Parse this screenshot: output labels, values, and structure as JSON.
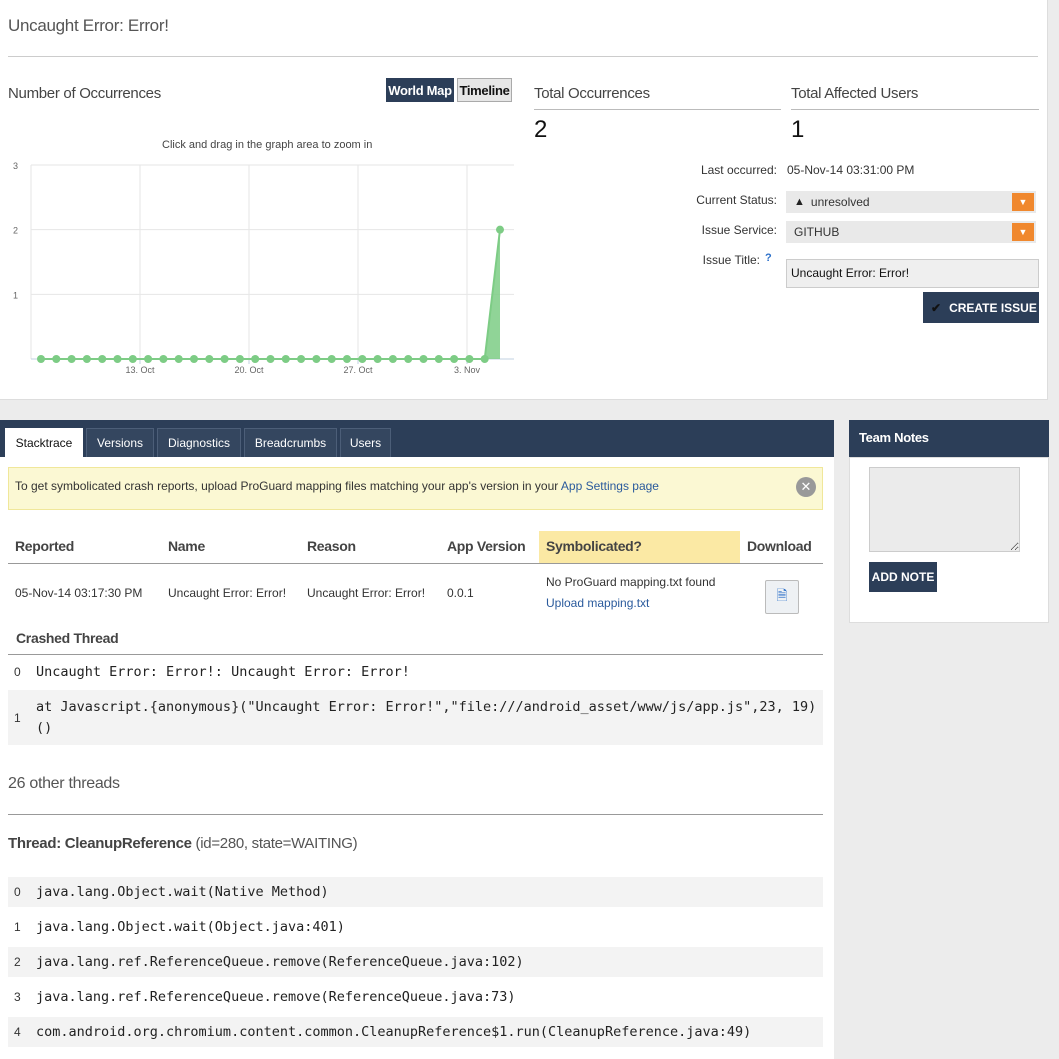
{
  "page": {
    "title": "Uncaught Error: Error!"
  },
  "occurrences": {
    "label": "Number of Occurrences",
    "world_map_label": "World Map",
    "timeline_label": "Timeline",
    "hint": "Click and drag in the graph area to zoom in"
  },
  "chart_data": {
    "type": "area",
    "x_tick_labels": [
      "13. Oct",
      "20. Oct",
      "27. Oct",
      "3. Nov"
    ],
    "y_tick_labels": [
      "1",
      "2",
      "3"
    ],
    "ylim": [
      0,
      3
    ],
    "values": [
      0,
      0,
      0,
      0,
      0,
      0,
      0,
      0,
      0,
      0,
      0,
      0,
      0,
      0,
      0,
      0,
      0,
      0,
      0,
      0,
      0,
      0,
      0,
      0,
      0,
      0,
      0,
      0,
      0,
      0,
      2
    ],
    "color": "#7dcc85",
    "grid": true
  },
  "stats": {
    "total_occurrences_label": "Total Occurrences",
    "total_occurrences_value": "2",
    "total_users_label": "Total Affected Users",
    "total_users_value": "1"
  },
  "meta": {
    "last_occurred_label": "Last occurred:",
    "last_occurred_value": "05-Nov-14 03:31:00 PM",
    "status_label": "Current Status:",
    "status_value": "unresolved",
    "status_icon": "warning-icon",
    "service_label": "Issue Service:",
    "service_value": "GITHUB",
    "issue_title_label": "Issue Title:",
    "issue_title_help": "?",
    "issue_title_value": "Uncaught Error: Error!",
    "create_issue_label": "CREATE ISSUE",
    "create_issue_icon": "check-icon"
  },
  "tabs": [
    "Stacktrace",
    "Versions",
    "Diagnostics",
    "Breadcrumbs",
    "Users"
  ],
  "notice": {
    "text": "To get symbolicated crash reports, upload ProGuard mapping files matching your app's version in your ",
    "link": "App Settings page",
    "close_icon": "close-icon"
  },
  "report_table": {
    "headers": [
      "Reported",
      "Name",
      "Reason",
      "App Version",
      "Symbolicated?",
      "Download"
    ],
    "row": {
      "reported": "05-Nov-14 03:17:30 PM",
      "name": "Uncaught Error: Error!",
      "reason": "Uncaught Error: Error!",
      "app_version": "0.0.1",
      "symbolicated": "No ProGuard mapping.txt found",
      "upload_link": "Upload mapping.txt",
      "download_icon": "document-icon"
    }
  },
  "crashed_thread": {
    "title": "Crashed Thread",
    "frames": [
      {
        "num": "0",
        "text": "Uncaught Error: Error!: Uncaught Error: Error!"
      },
      {
        "num": "1",
        "text": "at Javascript.{anonymous}(\"Uncaught Error: Error!\",\"file:///android_asset/www/js/app.js\",23, 19)()"
      }
    ]
  },
  "other_threads": {
    "count_label": "26 other threads",
    "thread_name": "Thread: CleanupReference",
    "thread_meta": " (id=280, state=WAITING)",
    "frames": [
      {
        "num": "0",
        "text": "java.lang.Object.wait(Native Method)"
      },
      {
        "num": "1",
        "text": "java.lang.Object.wait(Object.java:401)"
      },
      {
        "num": "2",
        "text": "java.lang.ref.ReferenceQueue.remove(ReferenceQueue.java:102)"
      },
      {
        "num": "3",
        "text": "java.lang.ref.ReferenceQueue.remove(ReferenceQueue.java:73)"
      },
      {
        "num": "4",
        "text": "com.android.org.chromium.content.common.CleanupReference$1.run(CleanupReference.java:49)"
      }
    ]
  },
  "team_notes": {
    "title": "Team Notes",
    "add_note_label": "ADD NOTE"
  }
}
